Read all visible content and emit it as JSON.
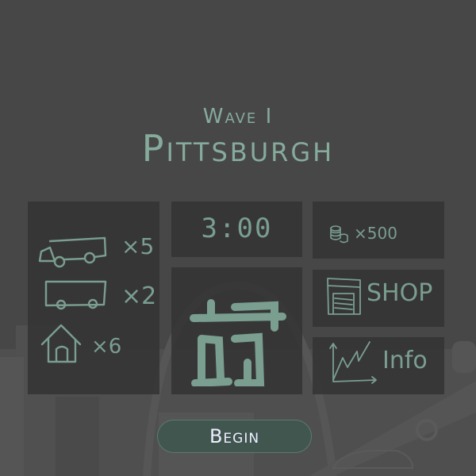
{
  "header": {
    "wave_label": "Wave I",
    "city": "Pittsburgh"
  },
  "enemies": [
    {
      "icon": "car-icon",
      "count": "×5"
    },
    {
      "icon": "bus-icon",
      "count": "×2"
    },
    {
      "icon": "house-icon",
      "count": "×6"
    }
  ],
  "timer": "3:00",
  "coins": {
    "icon": "coins-icon",
    "count": "×500"
  },
  "shop_label": "SHOP",
  "info_label": "Info",
  "begin_label": "Begin",
  "colors": {
    "accent": "#7a9e90",
    "button": "#40564f",
    "background": "#474747"
  }
}
